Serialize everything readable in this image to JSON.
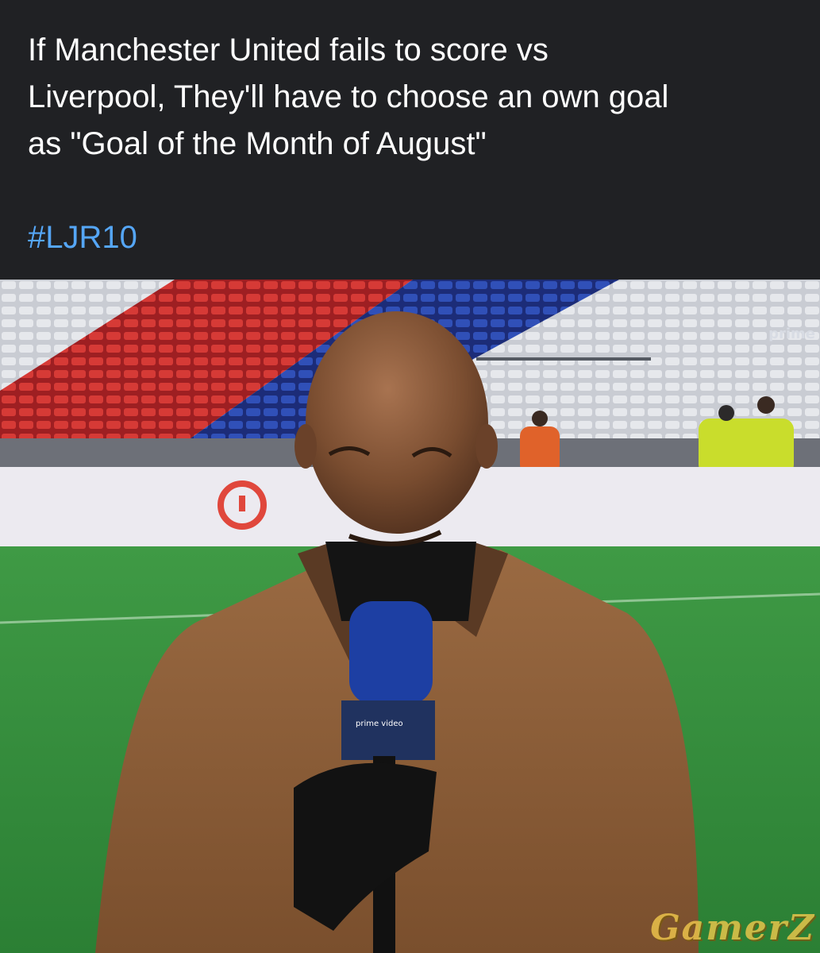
{
  "post": {
    "caption_lines": [
      "If Manchester United fails to score vs",
      "Liverpool, They'll have to choose an own goal",
      "as \"Goal of the Month of August\""
    ],
    "hashtag": "#LJR10"
  },
  "photo": {
    "description_labels": {
      "broadcaster_corner_logo": "prime",
      "watermark": "GamerZ"
    }
  },
  "colors": {
    "header_bg": "#202124",
    "caption_text": "#ffffff",
    "hashtag_text": "#55a6f6",
    "pitch_green": "#2f8a3a",
    "coat_brown": "#8a5a35",
    "seats_red": "#c93030",
    "seats_blue": "#2c45a8",
    "seats_white": "#d9dce2"
  }
}
